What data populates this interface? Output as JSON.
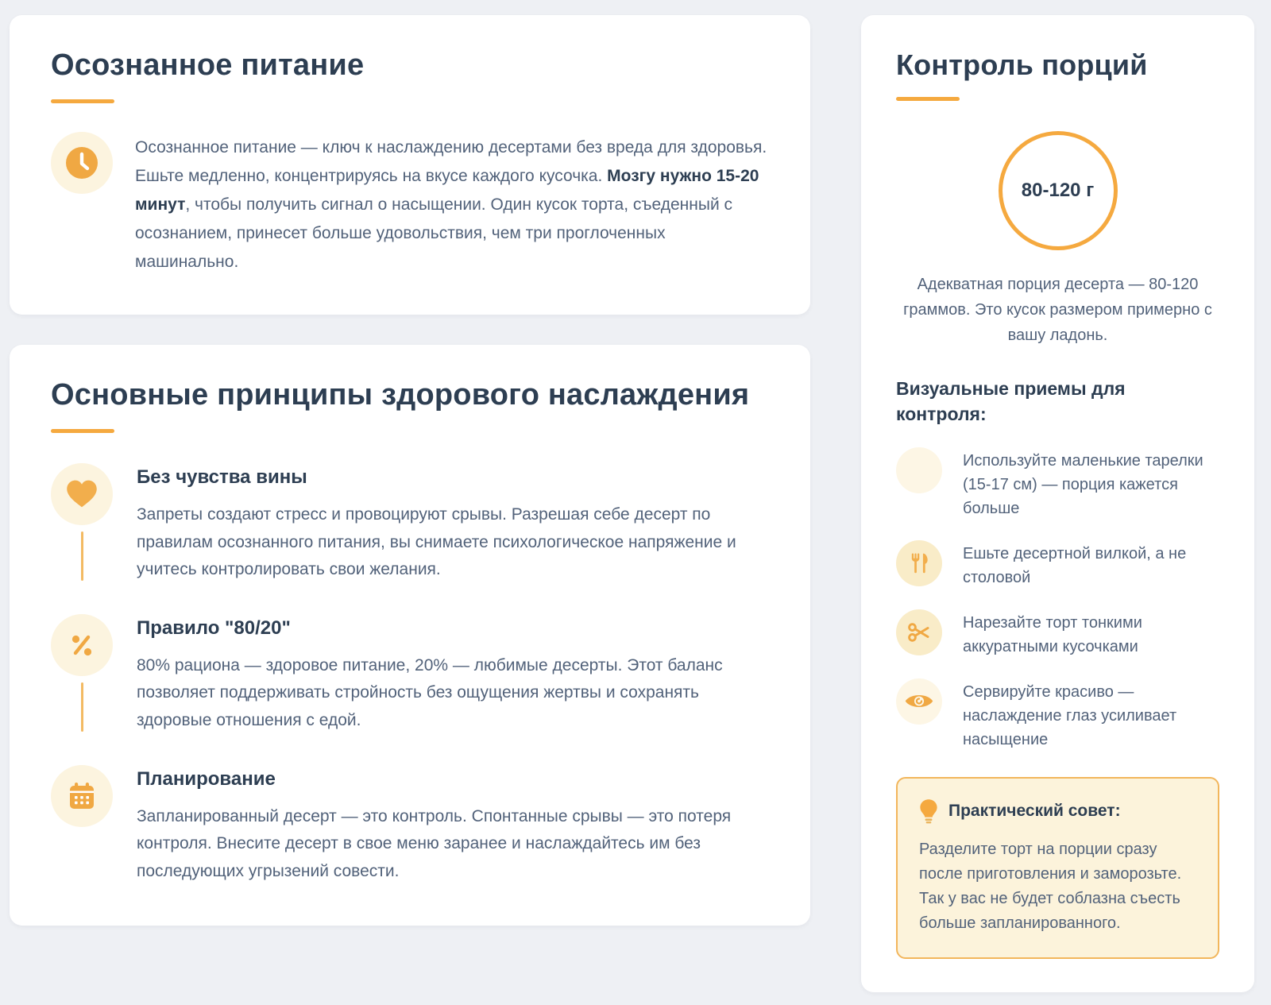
{
  "theme": {
    "accent_orange": "#F5A93F",
    "icon_orange": "#F0A843",
    "heading_color": "#2D3E52",
    "body_color": "#52627A",
    "page_background": "#EEF0F4",
    "card_background": "#FFFFFF",
    "bubble_cream": "#FCF4DF",
    "advice_background": "#FCF3DB",
    "advice_border": "#F2B65C"
  },
  "card_mindful": {
    "title": "Осознанное питание",
    "icon": "clock-icon",
    "paragraph": {
      "before_bold": "Осознанное питание — ключ к наслаждению десертами без вреда для здоровья. Ешьте медленно, концентрируясь на вкусе каждого кусочка. ",
      "bold": "Мозгу нужно 15-20 минут",
      "after_bold": ", чтобы получить сигнал о насыщении. Один кусок торта, съеденный с осознанием, принесет больше удовольствия, чем три проглоченных машинально."
    }
  },
  "card_principles": {
    "title": "Основные принципы здорового наслаждения",
    "items": [
      {
        "icon": "heart-icon",
        "heading": "Без чувства вины",
        "text": "Запреты создают стресс и провоцируют срывы. Разрешая себе десерт по правилам осознанного питания, вы снимаете психологическое напряжение и учитесь контролировать свои желания."
      },
      {
        "icon": "percent-icon",
        "heading": "Правило \"80/20\"",
        "text": "80% рациона — здоровое питание, 20% — любимые десерты. Этот баланс позволяет поддерживать стройность без ощущения жертвы и сохранять здоровые отношения с едой."
      },
      {
        "icon": "calendar-icon",
        "heading": "Планирование",
        "text": "Запланированный десерт — это контроль. Спонтанные срывы — это потеря контроля. Внесите десерт в свое меню заранее и наслаждайтесь им без последующих угрызений совести."
      }
    ]
  },
  "card_portions": {
    "title": "Контроль порций",
    "portion_value": "80-120 г",
    "portion_text": "Адекватная порция десерта — 80-120 граммов. Это кусок размером примерно с вашу ладонь.",
    "visual_heading": "Визуальные приемы для контроля:",
    "tips": [
      {
        "icon": "plate-icon",
        "text": "Используйте маленькие тарелки (15-17 см) — порция кажется больше"
      },
      {
        "icon": "cutlery-icon",
        "text": "Ешьте десертной вилкой, а не столовой"
      },
      {
        "icon": "scissors-icon",
        "text": "Нарезайте торт тонкими аккуратными кусочками"
      },
      {
        "icon": "eye-icon",
        "text": "Сервируйте красиво — наслаждение глаз усиливает насыщение"
      }
    ],
    "advice": {
      "icon": "lightbulb-icon",
      "title": "Практический совет:",
      "text": "Разделите торт на порции сразу после приготовления и заморозьте. Так у вас не будет соблазна съесть больше запланированного."
    }
  }
}
